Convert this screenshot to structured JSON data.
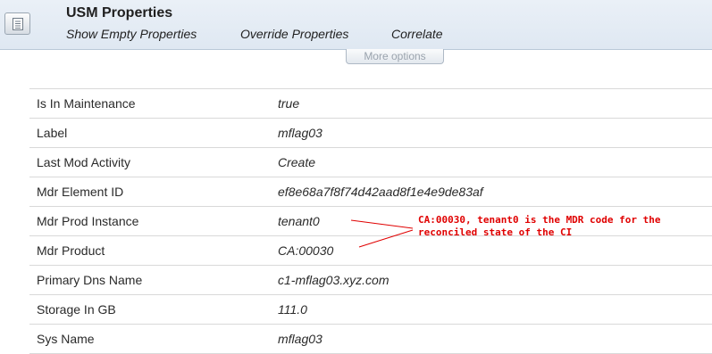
{
  "header": {
    "icon": "document-list-icon",
    "title": "USM Properties",
    "links": [
      "Show Empty Properties",
      "Override Properties",
      "Correlate"
    ]
  },
  "more_options_label": "More options",
  "properties": [
    {
      "key": "Is In Maintenance",
      "value": "true"
    },
    {
      "key": "Label",
      "value": "mflag03"
    },
    {
      "key": "Last Mod Activity",
      "value": "Create"
    },
    {
      "key": "Mdr Element ID",
      "value": "ef8e68a7f8f74d42aad8f1e4e9de83af"
    },
    {
      "key": "Mdr Prod Instance",
      "value": "tenant0"
    },
    {
      "key": "Mdr Product",
      "value": "CA:00030"
    },
    {
      "key": "Primary Dns Name",
      "value": "c1-mflag03.xyz.com"
    },
    {
      "key": "Storage In GB",
      "value": "111.0"
    },
    {
      "key": "Sys Name",
      "value": "mflag03"
    }
  ],
  "annotation": {
    "line1": "CA:00030, tenant0 is the MDR code for the",
    "line2": "reconciled state of the CI",
    "color": "#e00000"
  }
}
